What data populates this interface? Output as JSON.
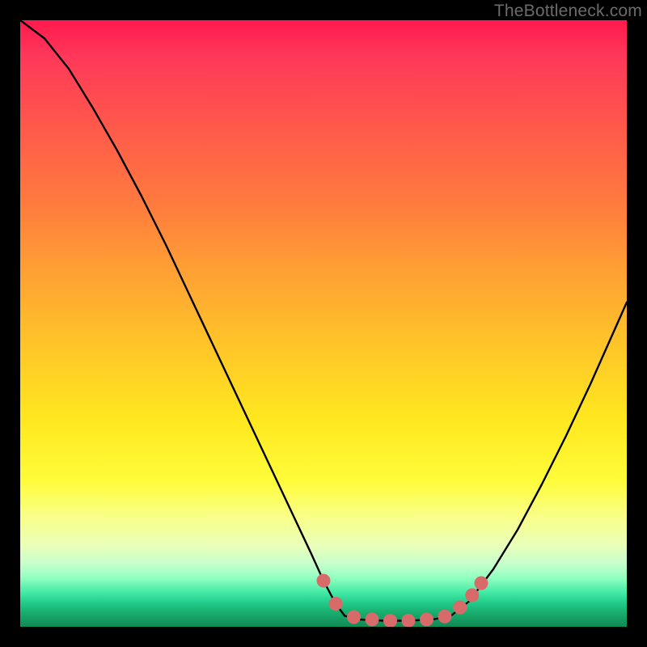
{
  "watermark": "TheBottleneck.com",
  "colors": {
    "page_bg": "#000000",
    "curve_stroke": "#000000",
    "marker_fill": "#d86a6a",
    "marker_stroke": "#d86a6a"
  },
  "chart_data": {
    "type": "line",
    "title": "",
    "xlabel": "",
    "ylabel": "",
    "xlim": [
      0,
      100
    ],
    "ylim": [
      0,
      100
    ],
    "series": [
      {
        "name": "left-curve",
        "x": [
          0,
          4,
          8,
          12,
          16,
          20,
          24,
          28,
          32,
          36,
          40,
          44,
          48,
          50,
          52,
          53.5
        ],
        "values": [
          100,
          97,
          92,
          85.5,
          78.5,
          71,
          63,
          54.5,
          46,
          37.5,
          29,
          20.5,
          12,
          7.6,
          3.8,
          1.8
        ]
      },
      {
        "name": "flat-bottom",
        "x": [
          53.5,
          56,
          60,
          64,
          68,
          71
        ],
        "values": [
          1.8,
          1.2,
          1.0,
          1.0,
          1.2,
          1.8
        ]
      },
      {
        "name": "right-curve",
        "x": [
          71,
          74,
          78,
          82,
          86,
          90,
          94,
          98,
          100
        ],
        "values": [
          1.8,
          4.2,
          9.5,
          16,
          23.5,
          31.5,
          40,
          49,
          53.5
        ]
      }
    ],
    "markers": {
      "name": "highlight-points",
      "color": "#d86a6a",
      "points": [
        {
          "x": 50.0,
          "y": 7.6
        },
        {
          "x": 52.0,
          "y": 3.8
        },
        {
          "x": 55.0,
          "y": 1.6
        },
        {
          "x": 58.0,
          "y": 1.2
        },
        {
          "x": 61.0,
          "y": 1.0
        },
        {
          "x": 64.0,
          "y": 1.0
        },
        {
          "x": 67.0,
          "y": 1.2
        },
        {
          "x": 70.0,
          "y": 1.7
        },
        {
          "x": 72.5,
          "y": 3.2
        },
        {
          "x": 74.5,
          "y": 5.2
        },
        {
          "x": 76.0,
          "y": 7.2
        }
      ]
    }
  }
}
